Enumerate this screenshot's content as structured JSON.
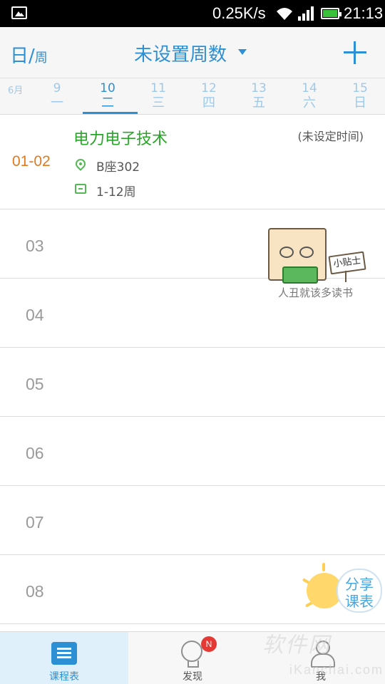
{
  "status_bar": {
    "net_speed": "0.25K/s",
    "time": "21:13"
  },
  "header": {
    "view_day": "日",
    "view_separator": "/",
    "view_week": "周",
    "week_title": "未设置周数"
  },
  "date_strip": {
    "month": "6月",
    "days": [
      {
        "num": "9",
        "weekday": "一"
      },
      {
        "num": "10",
        "weekday": "二"
      },
      {
        "num": "11",
        "weekday": "三"
      },
      {
        "num": "12",
        "weekday": "四"
      },
      {
        "num": "13",
        "weekday": "五"
      },
      {
        "num": "14",
        "weekday": "六"
      },
      {
        "num": "15",
        "weekday": "日"
      }
    ],
    "selected_index": 1
  },
  "course": {
    "period": "01-02",
    "name": "电力电子技术",
    "time": "(未设定时间)",
    "location": "B座302",
    "weeks": "1-12周"
  },
  "slots": [
    "03",
    "04",
    "05",
    "06",
    "07",
    "08"
  ],
  "tip": {
    "sign": "小贴士",
    "caption": "人丑就该多读书"
  },
  "share": {
    "label_line1": "分享",
    "label_line2": "课表"
  },
  "bottom_nav": {
    "items": [
      {
        "label": "课程表",
        "icon": "schedule-icon",
        "active": true
      },
      {
        "label": "发现",
        "icon": "lightbulb-icon",
        "badge": "N"
      },
      {
        "label": "我",
        "icon": "person-icon"
      }
    ]
  },
  "watermark": {
    "main": "软件网",
    "sub": "iKanchai.com"
  },
  "colors": {
    "accent": "#2d8fd4",
    "course": "#2aa52a",
    "period": "#e07b20",
    "badge": "#e53935"
  }
}
